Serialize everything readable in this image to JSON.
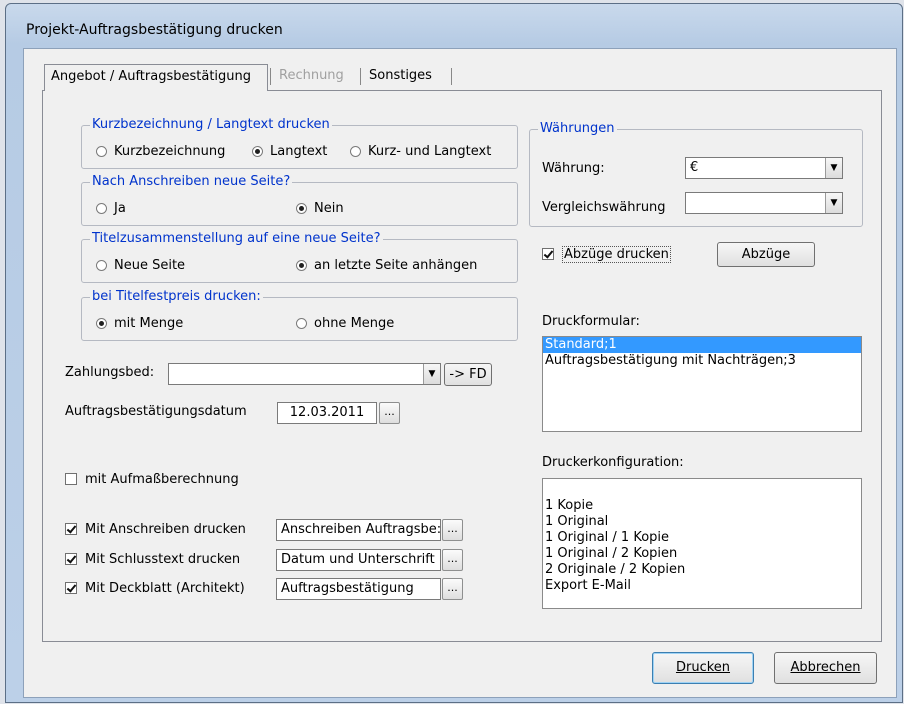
{
  "window": {
    "title": "Projekt-Auftragsbestätigung drucken"
  },
  "tabs": [
    {
      "label": "Angebot / Auftragsbestätigung",
      "active": true
    },
    {
      "label": "Rechnung",
      "disabled": true
    },
    {
      "label": "Sonstiges"
    }
  ],
  "kurz": {
    "legend": "Kurzbezeichnung / Langtext drucken",
    "options": [
      "Kurzbezeichnung",
      "Langtext",
      "Kurz- und Langtext"
    ],
    "selected": 1
  },
  "seite": {
    "legend": "Nach Anschreiben neue Seite?",
    "options": [
      "Ja",
      "Nein"
    ],
    "selected": 1
  },
  "titel": {
    "legend": "Titelzusammenstellung auf eine neue Seite?",
    "options": [
      "Neue Seite",
      "an letzte Seite anhängen"
    ],
    "selected": 1
  },
  "festpreis": {
    "legend": "bei Titelfestpreis drucken:",
    "options": [
      "mit Menge",
      "ohne Menge"
    ],
    "selected": 0
  },
  "zahlung": {
    "label": "Zahlungsbed:",
    "value": "",
    "fd_button": "-> FD"
  },
  "datum": {
    "label": "Auftragsbestätigungsdatum",
    "value": "12.03.2011",
    "dots": "..."
  },
  "aufmass": {
    "label": "mit Aufmaßberechnung",
    "checked": false
  },
  "anschreiben": {
    "label": "Mit Anschreiben drucken",
    "checked": true,
    "value": "Anschreiben Auftragsbe:"
  },
  "schluss": {
    "label": "Mit Schlusstext drucken",
    "checked": true,
    "value": "Datum und Unterschrift"
  },
  "deckblatt": {
    "label": "Mit Deckblatt (Architekt)",
    "checked": true,
    "value": "Auftragsbestätigung"
  },
  "waehrungen": {
    "legend": "Währungen",
    "waehrung_label": "Währung:",
    "waehrung_value": "€",
    "vergleich_label": "Vergleichswährung",
    "vergleich_value": ""
  },
  "abzuege": {
    "label": "Abzüge drucken",
    "checked": true,
    "button": "Abzüge"
  },
  "druckformular": {
    "label": "Druckformular:",
    "items": [
      "Standard;1",
      "Auftragsbestätigung mit Nachträgen;3"
    ],
    "selected": 0
  },
  "druckerkonfig": {
    "label": "Druckerkonfiguration:",
    "items": [
      "",
      "1 Kopie",
      "1 Original",
      "1 Original / 1 Kopie",
      "1 Original / 2 Kopien",
      "2 Originale / 2 Kopien",
      "Export E-Mail"
    ]
  },
  "buttons": {
    "drucken": "Drucken",
    "abbrechen": "Abbrechen"
  },
  "colors": {
    "accent": "#3399ff",
    "legend": "#0033cc",
    "chrome": "#bcd0e8"
  }
}
